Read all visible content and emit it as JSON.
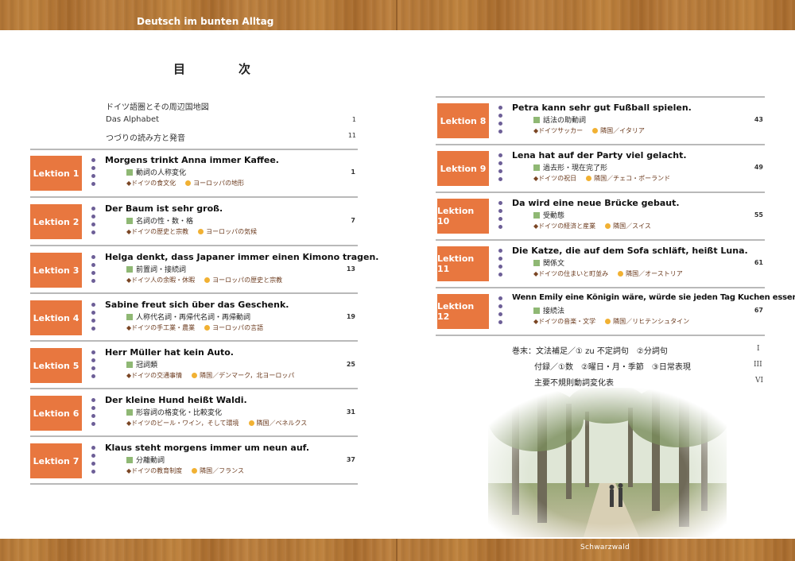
{
  "header": {
    "title": "Deutsch im bunten Alltag"
  },
  "toc": {
    "heading": "目　次",
    "front_matter": [
      {
        "label": "ドイツ語圏とその周辺国地図",
        "page": ""
      },
      {
        "label": "Das Alphabet",
        "page": "1"
      },
      {
        "label": "つづりの読み方と発音",
        "page": "11"
      }
    ],
    "lessons": [
      {
        "badge": "Lektion 1",
        "title": "Morgens trinkt Anna immer Kaffee.",
        "grammar": "動詞の人称変化",
        "culture1": "ドイツの食文化",
        "culture2": "ヨーロッパの地形",
        "page": "1"
      },
      {
        "badge": "Lektion 2",
        "title": "Der Baum ist sehr groß.",
        "grammar": "名詞の性・数・格",
        "culture1": "ドイツの歴史と宗教",
        "culture2": "ヨーロッパの気候",
        "page": "7"
      },
      {
        "badge": "Lektion 3",
        "title": "Helga denkt, dass Japaner immer einen Kimono tragen.",
        "grammar": "前置詞・接続詞",
        "culture1": "ドイツ人の余暇・休暇",
        "culture2": "ヨーロッパの歴史と宗教",
        "page": "13"
      },
      {
        "badge": "Lektion 4",
        "title": "Sabine freut sich über das Geschenk.",
        "grammar": "人称代名詞・再帰代名詞・再帰動詞",
        "culture1": "ドイツの手工業・農業",
        "culture2": "ヨーロッパの言語",
        "page": "19"
      },
      {
        "badge": "Lektion 5",
        "title": "Herr Müller hat kein Auto.",
        "grammar": "冠詞類",
        "culture1": "ドイツの交通事情",
        "culture2": "隣国／デンマーク，北ヨーロッパ",
        "page": "25"
      },
      {
        "badge": "Lektion 6",
        "title": "Der kleine Hund heißt Waldi.",
        "grammar": "形容詞の格変化・比較変化",
        "culture1": "ドイツのビール・ワイン，そして環境",
        "culture2": "隣国／ベネルクス",
        "page": "31"
      },
      {
        "badge": "Lektion 7",
        "title": "Klaus steht morgens immer um neun auf.",
        "grammar": "分離動詞",
        "culture1": "ドイツの教育制度",
        "culture2": "隣国／フランス",
        "page": "37"
      },
      {
        "badge": "Lektion 8",
        "title": "Petra kann sehr gut Fußball spielen.",
        "grammar": "話法の助動詞",
        "culture1": "ドイツサッカー",
        "culture2": "隣国／イタリア",
        "page": "43"
      },
      {
        "badge": "Lektion 9",
        "title": "Lena hat auf der Party viel gelacht.",
        "grammar": "過去形・現在完了形",
        "culture1": "ドイツの祝日",
        "culture2": "隣国／チェコ・ポーランド",
        "page": "49"
      },
      {
        "badge": "Lektion 10",
        "title": "Da wird eine neue Brücke gebaut.",
        "grammar": "受動態",
        "culture1": "ドイツの経済と産業",
        "culture2": "隣国／スイス",
        "page": "55"
      },
      {
        "badge": "Lektion 11",
        "title": "Die Katze, die auf dem Sofa schläft, heißt Luna.",
        "grammar": "関係文",
        "culture1": "ドイツの住まいと町並み",
        "culture2": "隣国／オーストリア",
        "page": "61"
      },
      {
        "badge": "Lektion 12",
        "title": "Wenn Emily eine Königin wäre, würde sie jeden Tag Kuchen essen.",
        "grammar": "接続法",
        "culture1": "ドイツの音楽・文学",
        "culture2": "隣国／リヒテンシュタイン",
        "page": "67"
      }
    ],
    "appendix": [
      {
        "label": "巻末：文法補足／① zu 不定詞句　②分詞句",
        "page": "I"
      },
      {
        "label": "付録／①数　②曜日・月・季節　③日常表現",
        "page": "III"
      },
      {
        "label": "主要不規則動詞変化表",
        "page": "VI"
      }
    ]
  },
  "photo": {
    "caption": "Schwarzwald"
  }
}
